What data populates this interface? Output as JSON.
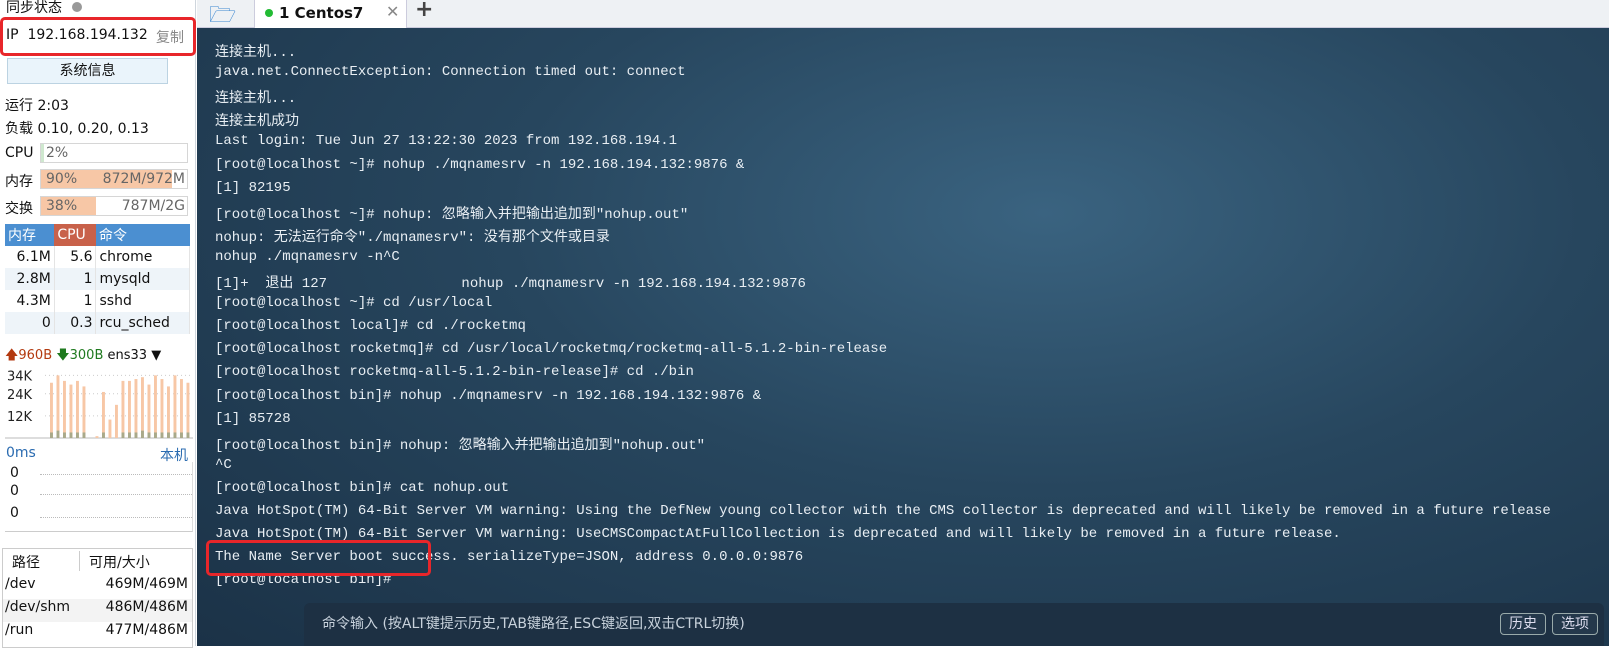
{
  "sidebar": {
    "sync_label": "同步状态",
    "ip_label": "IP",
    "ip": "192.168.194.132",
    "copy": "复制",
    "sysinfo": "系统信息",
    "uptime": "运行 2:03",
    "load": "负载 0.10, 0.20, 0.13",
    "cpu": {
      "label": "CPU",
      "text": "2%",
      "percent": 2
    },
    "mem": {
      "label": "内存",
      "text": "90%",
      "detail": "872M/972M",
      "percent": 90
    },
    "swap": {
      "label": "交换",
      "text": "38%",
      "detail": "787M/2G",
      "percent": 38
    },
    "proc_headers": [
      "内存",
      "CPU",
      "命令"
    ],
    "procs": [
      [
        "6.1M",
        "5.6",
        "chrome"
      ],
      [
        "2.8M",
        "1",
        "mysqld"
      ],
      [
        "4.3M",
        "1",
        "sshd"
      ],
      [
        "0",
        "0.3",
        "rcu_sched"
      ]
    ],
    "net": {
      "up": "960B",
      "down": "300B",
      "iface": "ens33",
      "ticks": [
        "34K",
        "24K",
        "12K"
      ],
      "upload_k": [
        30,
        34,
        31,
        29,
        31,
        28,
        0,
        1,
        25,
        10,
        18,
        31,
        31,
        32,
        33,
        29,
        34,
        32,
        28,
        34,
        32,
        30
      ],
      "download_k": [
        3,
        4,
        3,
        3,
        3,
        3,
        0,
        0,
        3,
        0,
        0,
        3,
        3,
        3,
        4,
        3,
        3,
        3,
        3,
        3,
        3,
        3
      ],
      "up_color": "#f7c7a6",
      "down_color": "#a9a98a"
    },
    "ping": {
      "label": "0ms",
      "host": "本机",
      "values": [
        "0",
        "0",
        "0"
      ]
    },
    "disk_headers": [
      "路径",
      "可用/大小"
    ],
    "disks": [
      [
        "/dev",
        "469M/469M"
      ],
      [
        "/dev/shm",
        "486M/486M"
      ],
      [
        "/run",
        "477M/486M"
      ]
    ]
  },
  "tabs": [
    {
      "label": "1 Centos7",
      "status_color": "#22bb33"
    }
  ],
  "terminal": {
    "lines": [
      "连接主机...",
      "java.net.ConnectException: Connection timed out: connect",
      "连接主机...",
      "连接主机成功",
      "Last login: Tue Jun 27 13:22:30 2023 from 192.168.194.1",
      "[root@localhost ~]# nohup ./mqnamesrv -n 192.168.194.132:9876 &",
      "[1] 82195",
      "[root@localhost ~]# nohup: 忽略输入并把输出追加到\"nohup.out\"",
      "nohup: 无法运行命令\"./mqnamesrv\": 没有那个文件或目录",
      "nohup ./mqnamesrv -n^C",
      "[1]+  退出 127                nohup ./mqnamesrv -n 192.168.194.132:9876",
      "[root@localhost ~]# cd /usr/local",
      "[root@localhost local]# cd ./rocketmq",
      "[root@localhost rocketmq]# cd /usr/local/rocketmq/rocketmq-all-5.1.2-bin-release",
      "[root@localhost rocketmq-all-5.1.2-bin-release]# cd ./bin",
      "[root@localhost bin]# nohup ./mqnamesrv -n 192.168.194.132:9876 &",
      "[1] 85728",
      "[root@localhost bin]# nohup: 忽略输入并把输出追加到\"nohup.out\"",
      "^C",
      "[root@localhost bin]# cat nohup.out",
      "Java HotSpot(TM) 64-Bit Server VM warning: Using the DefNew young collector with the CMS collector is deprecated and will likely be removed in a future release",
      "Java HotSpot(TM) 64-Bit Server VM warning: UseCMSCompactAtFullCollection is deprecated and will likely be removed in a future release.",
      "The Name Server boot success. serializeType=JSON, address 0.0.0.0:9876",
      "[root@localhost bin]#"
    ]
  },
  "cmdbar": {
    "placeholder": "命令输入 (按ALT键提示历史,TAB键路径,ESC键返回,双击CTRL切换)",
    "history": "历史",
    "options": "选项"
  }
}
